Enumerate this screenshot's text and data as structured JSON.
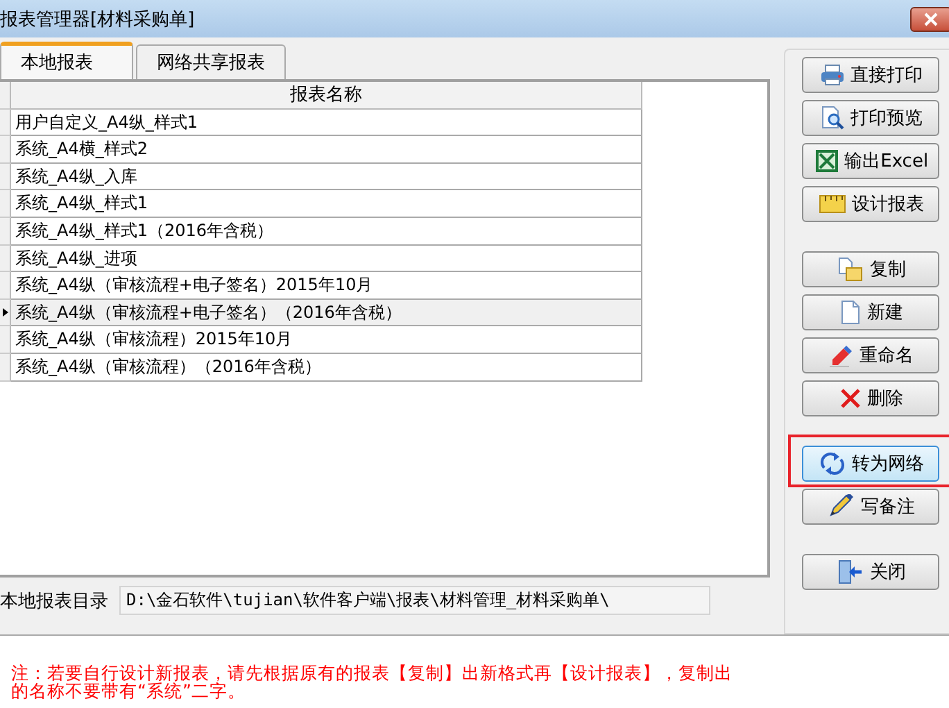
{
  "window": {
    "title": "报表管理器[材料采购单]"
  },
  "tabs": [
    {
      "label": "本地报表",
      "selected": true
    },
    {
      "label": "网络共享报表",
      "selected": false
    }
  ],
  "table": {
    "columns": [
      "报表名称"
    ],
    "rows": [
      {
        "name": "用户自定义_A4纵_样式1",
        "selected": false
      },
      {
        "name": "系统_A4横_样式2",
        "selected": false
      },
      {
        "name": "系统_A4纵_入库",
        "selected": false
      },
      {
        "name": "系统_A4纵_样式1",
        "selected": false
      },
      {
        "name": "系统_A4纵_样式1（2016年含税）",
        "selected": false
      },
      {
        "name": "系统_A4纵_进项",
        "selected": false
      },
      {
        "name": "系统_A4纵（审核流程+电子签名）2015年10月",
        "selected": false
      },
      {
        "name": "系统_A4纵（审核流程+电子签名）（2016年含税）",
        "selected": true
      },
      {
        "name": "系统_A4纵（审核流程）2015年10月",
        "selected": false
      },
      {
        "name": "系统_A4纵（审核流程）（2016年含税）",
        "selected": false
      }
    ]
  },
  "directory": {
    "label": "本地报表目录",
    "value": "D:\\金石软件\\tujian\\软件客户端\\报表\\材料管理_材料采购单\\"
  },
  "button_groups": [
    {
      "buttons": [
        {
          "label": "直接打印",
          "kind": "print",
          "highlighted": false
        },
        {
          "label": "打印预览",
          "kind": "preview",
          "highlighted": false
        },
        {
          "label": "输出Excel",
          "kind": "excel",
          "highlighted": false
        },
        {
          "label": "设计报表",
          "kind": "design",
          "highlighted": false
        }
      ]
    },
    {
      "buttons": [
        {
          "label": "复制",
          "kind": "copy",
          "highlighted": false
        },
        {
          "label": "新建",
          "kind": "new",
          "highlighted": false
        },
        {
          "label": "重命名",
          "kind": "rename",
          "highlighted": false
        },
        {
          "label": "删除",
          "kind": "delete",
          "highlighted": false
        }
      ]
    },
    {
      "buttons": [
        {
          "label": "转为网络",
          "kind": "network",
          "highlighted": true
        },
        {
          "label": "写备注",
          "kind": "note",
          "highlighted": false
        }
      ]
    },
    {
      "buttons": [
        {
          "label": "关闭",
          "kind": "close",
          "highlighted": false
        }
      ]
    }
  ],
  "note": "注：若要自行设计新报表，请先根据原有的报表【复制】出新格式再【设计报表】，复制出的名称不要带有“系统”二字。"
}
